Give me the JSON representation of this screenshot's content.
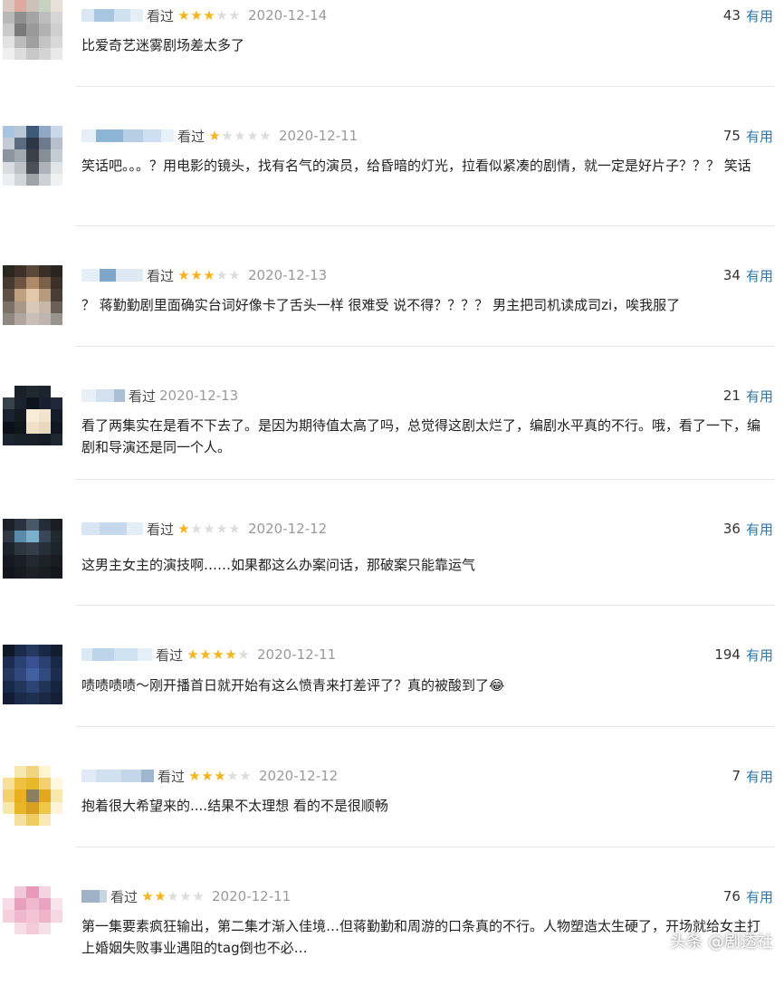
{
  "reviews": [
    {
      "status": "看过",
      "rating": 3,
      "date": "2020-12-14",
      "votes": "43",
      "useful_label": "有用",
      "text": "比爱奇艺迷雾剧场差太多了"
    },
    {
      "status": "看过",
      "rating": 1,
      "date": "2020-12-11",
      "votes": "75",
      "useful_label": "有用",
      "text": "笑话吧。。。？用电影的镜头，找有名气的演员，给昏暗的灯光，拉看似紧凑的剧情，就一定是好片子？？？ 笑话"
    },
    {
      "status": "看过",
      "rating": 3,
      "date": "2020-12-13",
      "votes": "34",
      "useful_label": "有用",
      "text": "？ 蒋勤勤剧里面确实台词好像卡了舌头一样 很难受 说不得？？？？ 男主把司机读成司zi，唉我服了"
    },
    {
      "status": "看过",
      "rating": 0,
      "date": "2020-12-13",
      "votes": "21",
      "useful_label": "有用",
      "text": "看了两集实在是看不下去了。是因为期待值太高了吗，总觉得这剧太烂了，编剧水平真的不行。哦，看了一下，编剧和导演还是同一个人。"
    },
    {
      "status": "看过",
      "rating": 1,
      "date": "2020-12-12",
      "votes": "36",
      "useful_label": "有用",
      "text": "这男主女主的演技啊……如果都这么办案问话，那破案只能靠运气"
    },
    {
      "status": "看过",
      "rating": 4,
      "date": "2020-12-11",
      "votes": "194",
      "useful_label": "有用",
      "text": "啧啧啧啧～刚开播首日就开始有这么愤青来打差评了？真的被酸到了😂"
    },
    {
      "status": "看过",
      "rating": 3,
      "date": "2020-12-12",
      "votes": "7",
      "useful_label": "有用",
      "text": "抱着很大希望来的....结果不太理想 看的不是很顺畅"
    },
    {
      "status": "看过",
      "rating": 2,
      "date": "2020-12-11",
      "votes": "76",
      "useful_label": "有用",
      "text": "第一集要素疯狂输出，第二集才渐入佳境…但蒋勤勤和周游的口条真的不行。人物塑造太生硬了，开场就给女主打上婚姻失败事业遇阻的tag倒也不必…"
    }
  ],
  "watermark": "头条 @剧透社",
  "colors": {
    "star_on": "#f5b320",
    "star_off": "#dddddd",
    "useful": "#3377aa",
    "date": "#9a9a9a"
  }
}
